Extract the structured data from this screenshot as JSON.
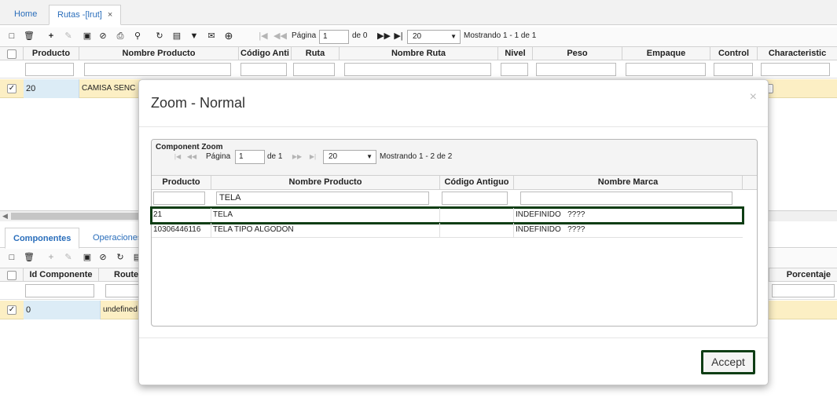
{
  "tabs": {
    "home": "Home",
    "active": "Rutas -[lrut]",
    "close": "×"
  },
  "main_toolbar": {
    "page_label": "Página",
    "page_value": "1",
    "of_label": "de 0",
    "page_size": "20",
    "showing": "Mostrando 1 - 1 de 1"
  },
  "main_grid": {
    "columns": [
      "Producto",
      "Nombre Producto",
      "Código Anti",
      "Ruta",
      "Nombre Ruta",
      "Nivel",
      "Peso",
      "Empaque",
      "Control",
      "Characteristic"
    ],
    "row": {
      "producto": "20",
      "nombre_producto": "CAMISA SENC"
    }
  },
  "sub_tabs": {
    "components": "Componentes",
    "operations": "Operaciones"
  },
  "sub_grid": {
    "columns": [
      "Id Componente",
      "Route",
      "Porcentaje"
    ],
    "row": {
      "id": "0",
      "route": "undefined"
    }
  },
  "modal": {
    "title": "Zoom - Normal",
    "close": "×",
    "panel_title": "Component Zoom",
    "page_label": "Página",
    "page_value": "1",
    "of_label": "de 1",
    "page_size": "20",
    "showing": "Mostrando 1 - 2 de 2",
    "columns": [
      "Producto",
      "Nombre Producto",
      "Código Antiguo",
      "Nombre Marca"
    ],
    "filter_value": "TELA",
    "rows": [
      {
        "producto": "21",
        "nombre": "TELA",
        "codigo": "",
        "marca": "INDEFINIDO   ????"
      },
      {
        "producto": "10306446116",
        "nombre": "TELA TIPO ALGODON",
        "codigo": "",
        "marca": "INDEFINIDO   ????"
      }
    ],
    "accept_label": "Accept"
  }
}
